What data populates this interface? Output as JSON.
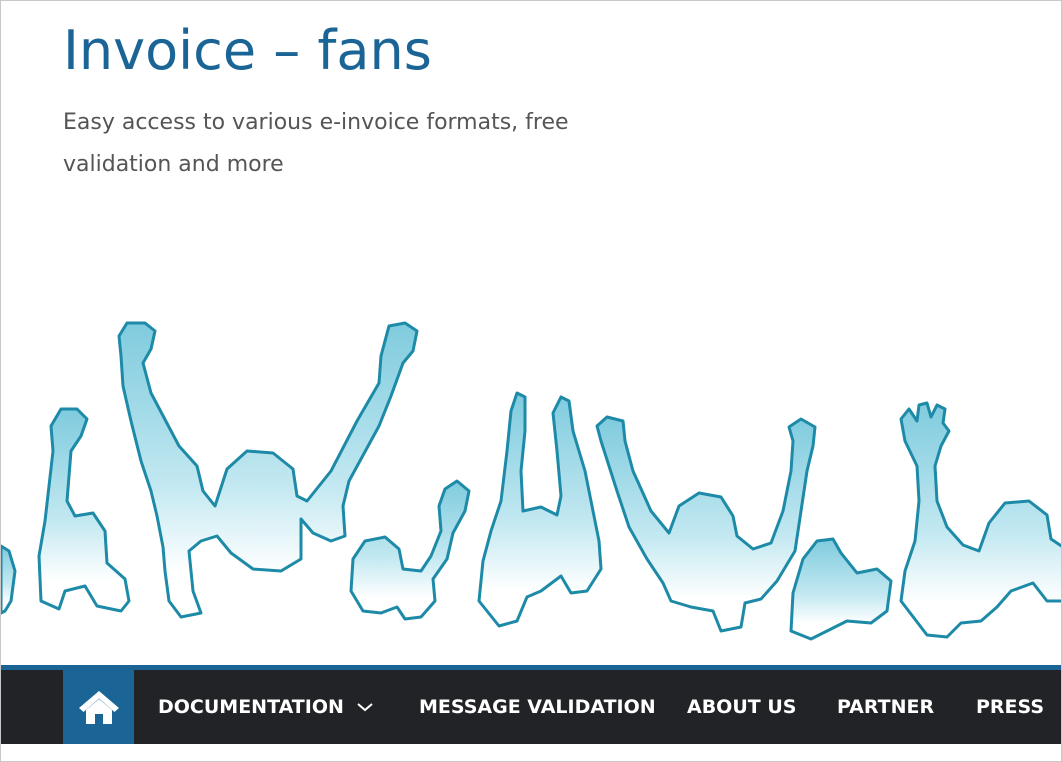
{
  "site": {
    "title": "Invoice – fans",
    "tagline": "Easy access to various e-invoice formats, free validation and more"
  },
  "hero": {
    "icon": "cheering-crowd-illustration"
  },
  "nav": {
    "home_icon": "home-icon",
    "items": [
      {
        "label": "DOCUMENTATION",
        "has_dropdown": true
      },
      {
        "label": "MESSAGE VALIDATION"
      },
      {
        "label": "ABOUT US"
      },
      {
        "label": "PARTNER"
      },
      {
        "label": "PRESS"
      }
    ]
  },
  "colors": {
    "brand": "#1a6496",
    "nav_bg": "#222326",
    "crowd_stroke": "#1d8aa8",
    "crowd_fill": "#8fd2e2"
  }
}
